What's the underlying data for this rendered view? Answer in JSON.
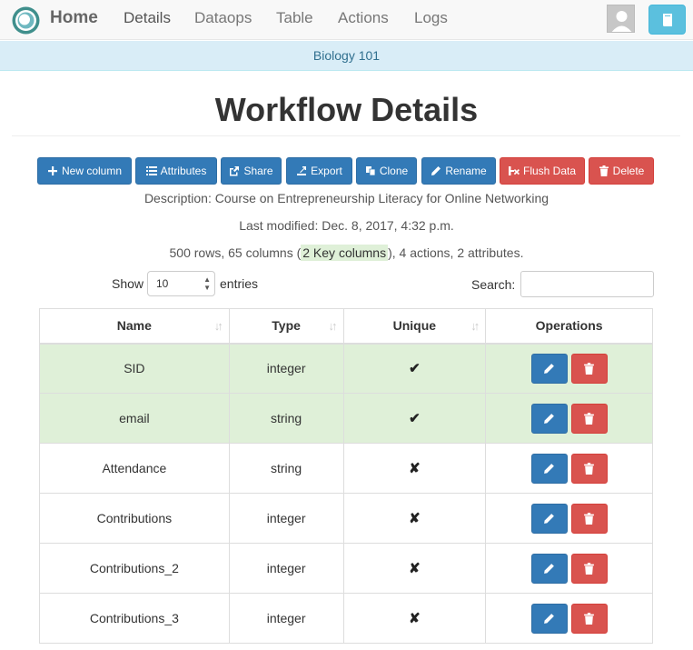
{
  "nav": {
    "home": "Home",
    "items": [
      "Details",
      "Dataops",
      "Table",
      "Actions",
      "Logs"
    ]
  },
  "course": "Biology 101",
  "title": "Workflow Details",
  "actions": {
    "new_column": "New column",
    "attributes": "Attributes",
    "share": "Share",
    "export": "Export",
    "clone": "Clone",
    "rename": "Rename",
    "flush": "Flush Data",
    "delete": "Delete"
  },
  "info": {
    "description": "Description: Course on Entrepreneurship Literacy for Online Networking",
    "last_modified": "Last modified: Dec. 8, 2017, 4:32 p.m.",
    "summary_prefix": "500 rows, 65 columns (",
    "key_columns": "2 Key columns",
    "summary_suffix": "), 4 actions, 2 attributes."
  },
  "length": {
    "show": "Show",
    "value": "10",
    "entries": "entries"
  },
  "search": {
    "label": "Search:",
    "value": ""
  },
  "table": {
    "headers": [
      "Name",
      "Type",
      "Unique",
      "Operations"
    ],
    "rows": [
      {
        "name": "SID",
        "type": "integer",
        "unique": "✔",
        "key": true
      },
      {
        "name": "email",
        "type": "string",
        "unique": "✔",
        "key": true
      },
      {
        "name": "Attendance",
        "type": "string",
        "unique": "✘",
        "key": false
      },
      {
        "name": "Contributions",
        "type": "integer",
        "unique": "✘",
        "key": false
      },
      {
        "name": "Contributions_2",
        "type": "integer",
        "unique": "✘",
        "key": false
      },
      {
        "name": "Contributions_3",
        "type": "integer",
        "unique": "✘",
        "key": false
      }
    ]
  },
  "colors": {
    "primary": "#337ab7",
    "danger": "#d9534f",
    "key_row": "#dff0d8",
    "info_bar": "#d9edf7",
    "help": "#5bc0de"
  }
}
